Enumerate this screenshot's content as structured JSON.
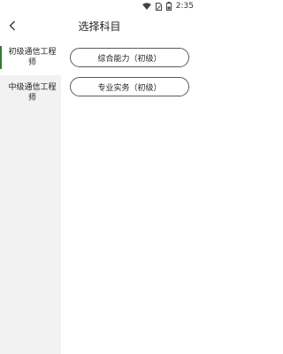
{
  "status_bar": {
    "time": "2:35"
  },
  "header": {
    "title": "选择科目"
  },
  "sidebar": {
    "items": [
      {
        "label": "初级通信工程师",
        "active": true
      },
      {
        "label": "中级通信工程师",
        "active": false
      }
    ]
  },
  "subjects": [
    {
      "label": "综合能力（初级）"
    },
    {
      "label": "专业实务（初级）"
    }
  ],
  "colors": {
    "accent": "#2e7d32",
    "sidebar_bg": "#f2f2f2"
  }
}
